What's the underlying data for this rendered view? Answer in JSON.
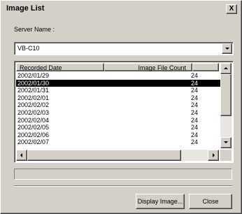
{
  "window": {
    "title": "Image List",
    "close_glyph": "X"
  },
  "server": {
    "label": "Server Name :",
    "selected": "VB-C10"
  },
  "list": {
    "columns": [
      "Recorded Date",
      "Image File Count"
    ],
    "rows": [
      {
        "date": "2002/01/29",
        "count": "24"
      },
      {
        "date": "2002/01/30",
        "count": "24",
        "selected": true
      },
      {
        "date": "2002/01/31",
        "count": "24"
      },
      {
        "date": "2002/02/01",
        "count": "24"
      },
      {
        "date": "2002/02/02",
        "count": "24"
      },
      {
        "date": "2002/02/03",
        "count": "24"
      },
      {
        "date": "2002/02/04",
        "count": "24"
      },
      {
        "date": "2002/02/05",
        "count": "24"
      },
      {
        "date": "2002/02/06",
        "count": "24"
      },
      {
        "date": "2002/02/07",
        "count": "24"
      }
    ]
  },
  "buttons": {
    "display_image": "Display Image...",
    "close": "Close"
  },
  "colors": {
    "selection": "#000000",
    "face": "#d4d0c8"
  }
}
